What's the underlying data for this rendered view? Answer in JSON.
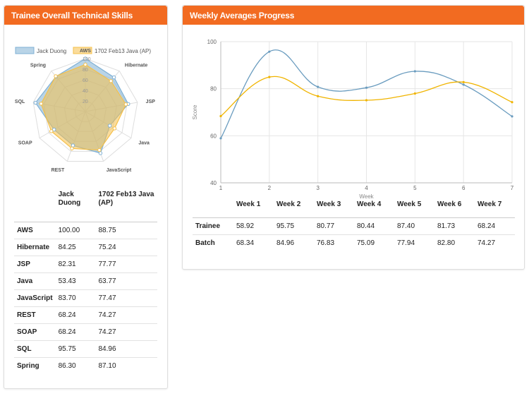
{
  "left_panel": {
    "title": "Trainee Overall Technical Skills",
    "legend": [
      {
        "label": "Jack Duong",
        "color": "#7fb0d4"
      },
      {
        "label": "1702 Feb13 Java (AP)",
        "color": "#f5c04a"
      }
    ],
    "table": {
      "headers": [
        "",
        "Jack Duong",
        "1702 Feb13 Java (AP)"
      ],
      "rows": [
        [
          "AWS",
          "100.00",
          "88.75"
        ],
        [
          "Hibernate",
          "84.25",
          "75.24"
        ],
        [
          "JSP",
          "82.31",
          "77.77"
        ],
        [
          "Java",
          "53.43",
          "63.77"
        ],
        [
          "JavaScript",
          "83.70",
          "77.47"
        ],
        [
          "REST",
          "68.24",
          "74.27"
        ],
        [
          "SOAP",
          "68.24",
          "74.27"
        ],
        [
          "SQL",
          "95.75",
          "84.96"
        ],
        [
          "Spring",
          "86.30",
          "87.10"
        ]
      ]
    }
  },
  "right_panel": {
    "title": "Weekly Averages Progress",
    "table": {
      "headers": [
        "",
        "Week 1",
        "Week 2",
        "Week 3",
        "Week 4",
        "Week 5",
        "Week 6",
        "Week 7"
      ],
      "rows": [
        [
          "Trainee",
          "58.92",
          "95.75",
          "80.77",
          "80.44",
          "87.40",
          "81.73",
          "68.24"
        ],
        [
          "Batch",
          "68.34",
          "84.96",
          "76.83",
          "75.09",
          "77.94",
          "82.80",
          "74.27"
        ]
      ]
    }
  },
  "chart_data": [
    {
      "type": "radar",
      "categories": [
        "AWS",
        "Hibernate",
        "JSP",
        "Java",
        "JavaScript",
        "REST",
        "SOAP",
        "SQL",
        "Spring"
      ],
      "series": [
        {
          "name": "Jack Duong",
          "values": [
            100.0,
            84.25,
            82.31,
            53.43,
            83.7,
            68.24,
            68.24,
            95.75,
            86.3
          ],
          "color": "#7fb0d4"
        },
        {
          "name": "1702 Feb13 Java (AP)",
          "values": [
            88.75,
            75.24,
            77.77,
            63.77,
            77.47,
            74.27,
            74.27,
            84.96,
            87.1
          ],
          "color": "#f5c04a"
        }
      ],
      "r_ticks": [
        "0",
        "20",
        "40",
        "60",
        "80",
        "100"
      ],
      "rlim": [
        0,
        100
      ]
    },
    {
      "type": "line",
      "x": [
        1,
        2,
        3,
        4,
        5,
        6,
        7
      ],
      "x_ticks": [
        "1",
        "2",
        "3",
        "4",
        "5",
        "6",
        "7"
      ],
      "series": [
        {
          "values": [
            58.92,
            95.75,
            80.77,
            80.44,
            87.4,
            81.73,
            68.24
          ],
          "color": "#6a9cbf"
        },
        {
          "values": [
            68.34,
            84.96,
            76.83,
            75.09,
            77.94,
            82.8,
            74.27
          ],
          "color": "#f0b400"
        }
      ],
      "xlabel": "Week",
      "ylabel": "Score",
      "y_ticks": [
        "100",
        "80",
        "60",
        "40"
      ],
      "ylim": [
        40,
        100
      ],
      "xlim": [
        1,
        7
      ],
      "grid": true
    }
  ]
}
